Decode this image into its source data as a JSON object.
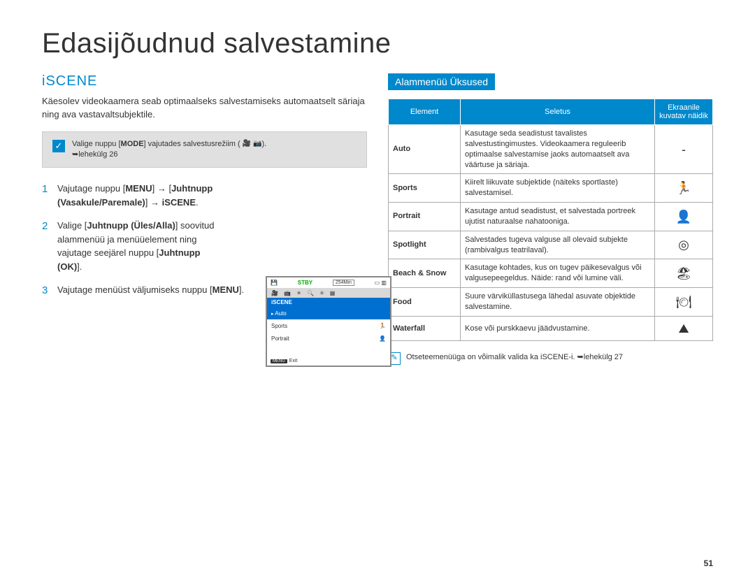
{
  "page_title": "Edasijõudnud salvestamine",
  "page_number": "51",
  "left": {
    "heading": "iSCENE",
    "intro": "Käesolev videokaamera seab optimaalseks salvestamiseks automaatselt säriaja ning ava vastavaltsubjektile.",
    "infobox": {
      "pre": "Valige nuppu [",
      "mode": "MODE",
      "post": "] vajutades salvestusrežiim (",
      "icons": "🎥 📷",
      "tail": ").",
      "page_ref": "➥lehekülg 26"
    },
    "steps": [
      {
        "parts": [
          {
            "t": "Vajutage nuppu ["
          },
          {
            "t": "MENU",
            "b": true
          },
          {
            "t": "] → ["
          },
          {
            "t": "Juhtnupp (Vasakule/Paremale)",
            "b": true
          },
          {
            "t": "] → "
          },
          {
            "t": "iSCENE",
            "b": true
          },
          {
            "t": "."
          }
        ]
      },
      {
        "parts": [
          {
            "t": "Valige ["
          },
          {
            "t": "Juhtnupp (Üles/Alla)",
            "b": true
          },
          {
            "t": "] soovitud alammenüü ja menüüelement ning vajutage seejärel nuppu ["
          },
          {
            "t": "Juhtnupp (OK)",
            "b": true
          },
          {
            "t": "]."
          }
        ]
      },
      {
        "parts": [
          {
            "t": "Vajutage menüüst väljumiseks nuppu ["
          },
          {
            "t": "MENU",
            "b": true
          },
          {
            "t": "]."
          }
        ]
      }
    ],
    "lcd": {
      "stby": "STBY",
      "time": "254Min",
      "title": "iSCENE",
      "items": [
        "Auto",
        "Sports",
        "Portrait"
      ],
      "exit_label": "Exit",
      "menu_badge": "MENU"
    }
  },
  "right": {
    "heading": "Alammenüü Üksused",
    "table": {
      "headers": [
        "Element",
        "Seletus",
        "Ekraanile kuvatav näidik"
      ],
      "rows": [
        {
          "elem": "Auto",
          "desc": "Kasutage seda seadistust tavalistes salvestustingimustes. Videokaamera reguleerib optimaalse salvestamise jaoks automaatselt ava väärtuse ja säriaja.",
          "icon": "-"
        },
        {
          "elem": "Sports",
          "desc": "Kiirelt liikuvate subjektide (näiteks sportlaste) salvestamisel.",
          "icon": "🏃"
        },
        {
          "elem": "Portrait",
          "desc": "Kasutage antud seadistust, et salvestada portreek ujutist naturaalse nahatooniga.",
          "icon": "👤"
        },
        {
          "elem": "Spotlight",
          "desc": "Salvestades tugeva valguse all olevaid subjekte (rambivalgus teatrilaval).",
          "icon": "◎"
        },
        {
          "elem": "Beach & Snow",
          "desc": "Kasutage kohtades, kus on tugev päikesevalgus või valgusepeegeldus. Näide: rand või lumine väli.",
          "icon": "🏖"
        },
        {
          "elem": "Food",
          "desc": "Suure värviküllastusega lähedal asuvate objektide salvestamine.",
          "icon": "🍽"
        },
        {
          "elem": "Waterfall",
          "desc": "Kose või purskkaevu jäädvustamine.",
          "icon": "⛰"
        }
      ]
    },
    "footnote": "Otseteemenüüga on võimalik valida ka iSCENE-i. ➥lehekülg 27"
  }
}
